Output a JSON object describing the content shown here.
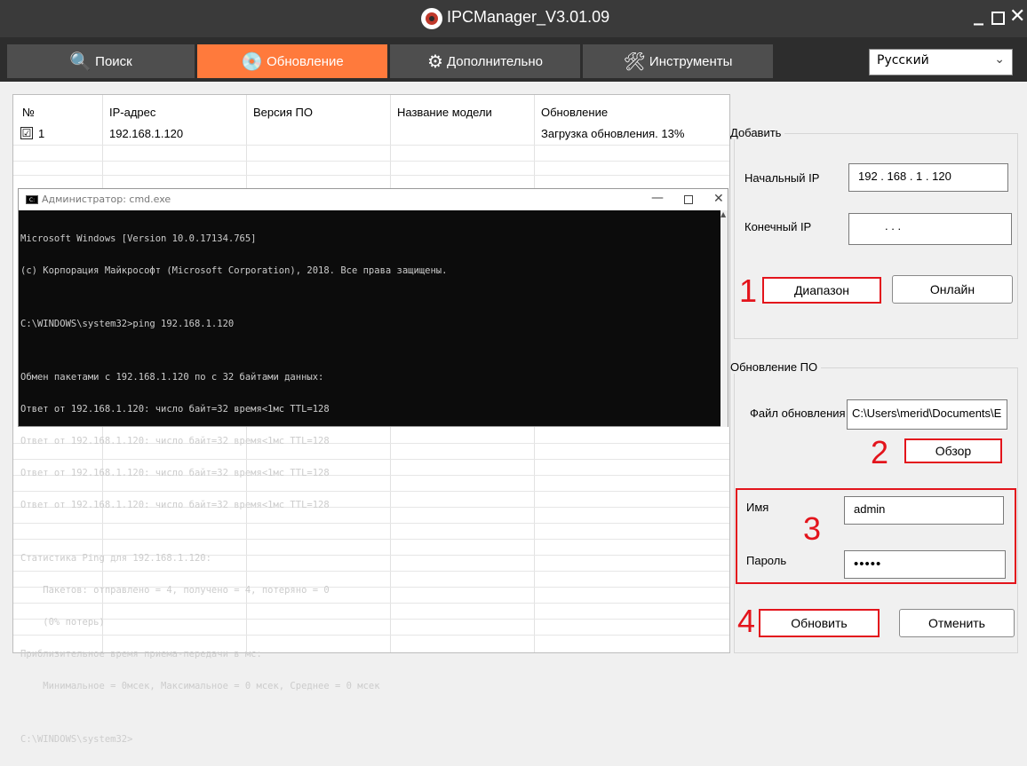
{
  "window": {
    "title": "IPCManager_V3.01.09",
    "min": "_",
    "close": "✕"
  },
  "tabs": [
    {
      "label": "Поиск",
      "icon": "search-icon",
      "glyph": "🔍"
    },
    {
      "label": "Обновление",
      "icon": "upgrade-icon",
      "glyph": "💿"
    },
    {
      "label": "Дополнительно",
      "icon": "gear-icon",
      "glyph": "⚙"
    },
    {
      "label": "Инструменты",
      "icon": "tools-icon",
      "glyph": "🛠"
    }
  ],
  "language": {
    "selected": "Русский",
    "arrow": "⌄"
  },
  "table": {
    "columns": [
      "№",
      "IP-адрес",
      "Версия ПО",
      "Название модели",
      "Обновление"
    ],
    "rows": [
      {
        "checked": "☑",
        "no": "1",
        "ip": "192.168.1.120",
        "version": "",
        "model": "",
        "status": "Загрузка обновления. 13%"
      }
    ]
  },
  "cmd": {
    "title": "Администратор: cmd.exe",
    "min": "—",
    "close": "✕",
    "scroll_up": "▲",
    "lines": [
      "Microsoft Windows [Version 10.0.17134.765]",
      "(c) Корпорация Майкрософт (Microsoft Corporation), 2018. Все права защищены.",
      "",
      "C:\\WINDOWS\\system32>ping 192.168.1.120",
      "",
      "Обмен пакетами с 192.168.1.120 по с 32 байтами данных:",
      "Ответ от 192.168.1.120: число байт=32 время<1мс TTL=128",
      "Ответ от 192.168.1.120: число байт=32 время<1мс TTL=128",
      "Ответ от 192.168.1.120: число байт=32 время<1мс TTL=128",
      "Ответ от 192.168.1.120: число байт=32 время<1мс TTL=128",
      "",
      "Статистика Ping для 192.168.1.120:",
      "    Пакетов: отправлено = 4, получено = 4, потеряно = 0",
      "    (0% потерь)",
      "Приблизительное время приема-передачи в мс:",
      "    Минимальное = 0мсек, Максимальное = 0 мсек, Среднее = 0 мсек",
      "",
      "C:\\WINDOWS\\system32>"
    ]
  },
  "add": {
    "group_label": "Добавить",
    "start_ip_label": "Начальный IP",
    "start_ip": "192 . 168 .  1  . 120",
    "end_ip_label": "Конечный IP",
    "end_ip": ".        .        .",
    "range_button": "Диапазон",
    "online_button": "Онлайн"
  },
  "firmware": {
    "group_label": "Обновление ПО",
    "file_label": "Файл обновления",
    "file_path": "C:\\Users\\merid\\Documents\\E",
    "browse_button": "Обзор",
    "name_label": "Имя",
    "name_value": "admin",
    "password_label": "Пароль",
    "password_value": "•••••",
    "update_button": "Обновить",
    "cancel_button": "Отменить"
  },
  "annotations": {
    "n1": "1",
    "n2": "2",
    "n3": "3",
    "n4": "4"
  },
  "colors": {
    "accent": "#ff7a3c",
    "annotation": "#e3141c",
    "titlebar": "#3a3a3a"
  }
}
